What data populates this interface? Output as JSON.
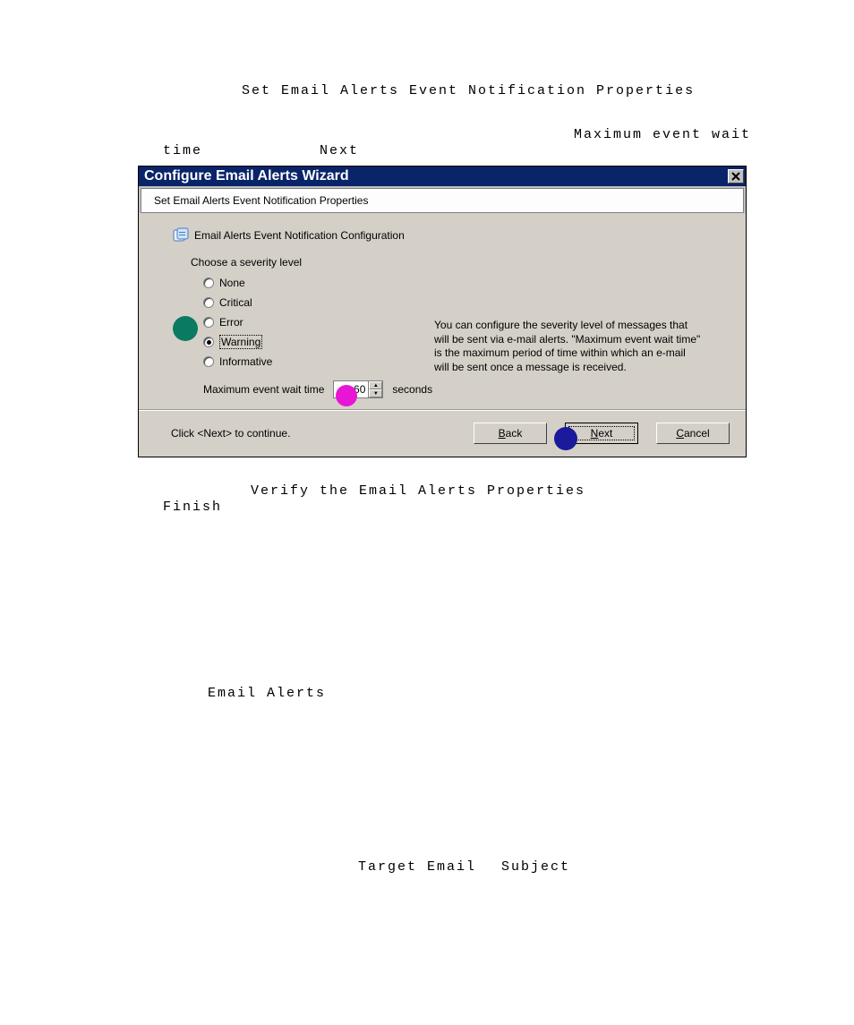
{
  "doc": {
    "heading": "Set Email Alerts Event Notification Properties",
    "wait_label": "Maximum event wait",
    "time_word": "time",
    "next_word": "Next",
    "verify_line": "Verify the Email Alerts Properties",
    "finish_word": "Finish",
    "email_alerts": "Email Alerts",
    "target_email": "Target Email",
    "subject": "Subject"
  },
  "dialog": {
    "title": "Configure Email Alerts Wizard",
    "subtitle": "Set Email Alerts Event Notification Properties",
    "config_heading": "Email Alerts Event Notification Configuration",
    "severity_label": "Choose a severity level",
    "options": {
      "none": "None",
      "critical": "Critical",
      "error": "Error",
      "warning": "Warning",
      "informative": "Informative"
    },
    "selected": "warning",
    "help": "You can configure the severity level of messages that will be sent via e-mail alerts. \"Maximum event wait time\" is the maximum period of time within which an e-mail will be sent once a message is received.",
    "wait_label": "Maximum event wait time",
    "wait_value": "60",
    "wait_unit": "seconds",
    "footer_hint": "Click <Next> to continue.",
    "buttons": {
      "back": "Back",
      "next": "Next",
      "cancel": "Cancel"
    }
  },
  "dots": {
    "teal": "#0a7a63",
    "magenta": "#e815d4",
    "blue": "#1a1a9a"
  }
}
